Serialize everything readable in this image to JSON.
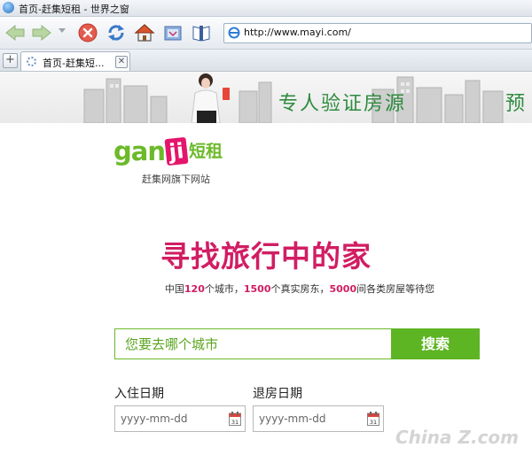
{
  "window": {
    "title": "首页-赶集短租 - 世界之窗"
  },
  "toolbar": {
    "back_icon": "back-arrow-icon",
    "forward_icon": "forward-arrow-icon",
    "stop_icon": "stop-icon",
    "refresh_icon": "refresh-icon",
    "home_icon": "home-icon",
    "favorites_icon": "favorites-icon",
    "reader_icon": "book-icon"
  },
  "address": {
    "url": "http://www.mayi.com/"
  },
  "tabs": [
    {
      "label": "首页-赶集短..."
    }
  ],
  "tabstrip": {
    "new_tab": "+",
    "close": "✕"
  },
  "banner": {
    "slogan": "专人验证房源",
    "slogan_cut": "预"
  },
  "logo": {
    "gan": "gan",
    "ji": "ji",
    "duan": "短租",
    "subtitle": "赶集网旗下网站"
  },
  "hero": {
    "headline": "寻找旅行中的家",
    "stats": {
      "p1": "中国",
      "n1": "120",
      "p2": "个城市，",
      "n2": "1500",
      "p3": "个真实房东，",
      "n3": "5000",
      "p4": "间各类房屋等待您"
    }
  },
  "search": {
    "placeholder": "您要去哪个城市",
    "button_label": "搜索"
  },
  "dates": {
    "checkin_label": "入住日期",
    "checkout_label": "退房日期",
    "checkin_placeholder": "yyyy-mm-dd",
    "checkout_placeholder": "yyyy-mm-dd",
    "calendar_day": "31"
  },
  "watermark": {
    "text": "China Z.com"
  },
  "colors": {
    "brand_green": "#5db523",
    "brand_magenta": "#d11d63"
  }
}
